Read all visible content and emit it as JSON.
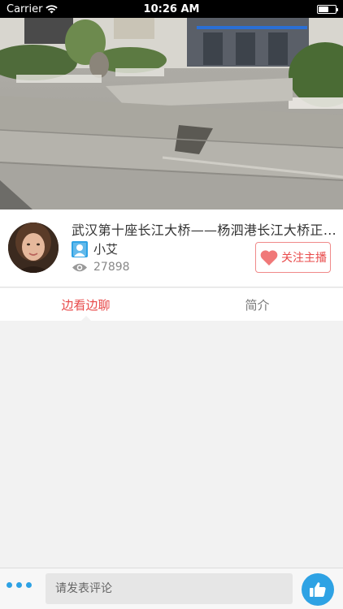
{
  "status_bar": {
    "carrier": "Carrier",
    "time": "10:26 AM",
    "battery_level": 0.6
  },
  "video": {
    "description_icon": "street-scene-video"
  },
  "stream": {
    "title": "武汉第十座长江大桥——杨泗港长江大桥正…",
    "host_name": "小艾",
    "view_count": "27898",
    "follow_label": "关注主播"
  },
  "tabs": [
    {
      "label": "边看边聊",
      "active": true
    },
    {
      "label": "简介",
      "active": false
    }
  ],
  "comment": {
    "placeholder": "请发表评论"
  },
  "colors": {
    "accent_red": "#e84a4a",
    "accent_blue": "#2ea2e4",
    "follow_heart": "#f07878"
  }
}
